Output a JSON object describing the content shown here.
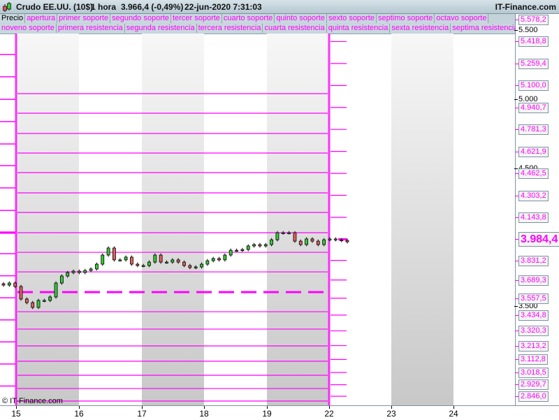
{
  "header": {
    "instrument": "Crudo EE.UU. (10$)",
    "timeframe": "1 hora",
    "last_change": "3.966,4 (-0,49%)",
    "datetime": "22-jun-2020 7:31:03",
    "site": "IT-Finance.com"
  },
  "legend": {
    "row1": [
      "Precio",
      "apertura",
      "primer soporte",
      "segundo soporte",
      "tercer soporte",
      "cuarto soporte",
      "quinto soporte",
      "sexto soporte",
      "septimo soporte",
      "octavo soporte"
    ],
    "row2": [
      "noveno soporte",
      "primera resistencia",
      "segunda resistencia",
      "tercera resistencia",
      "cuarta resistencia",
      "quinta resistencia",
      "sexta resistencia",
      "septima resistencia"
    ]
  },
  "copyright": "© IT-Finance.com",
  "colors": {
    "levels": "#ff00ff",
    "up": "#33cc33",
    "down": "#e06060",
    "axis": "#7d939e"
  },
  "chart_data": {
    "type": "candlestick",
    "ylim": [
      2846.0,
      5578.2
    ],
    "price_labels": [
      "5.578,2",
      "5.418,8",
      "5.259,4",
      "5.100,0",
      "4.940,7",
      "4.781,3",
      "4.621,9",
      "4.462,5",
      "4.303,2",
      "4.143,8",
      "3.831,2",
      "3.689,3",
      "3.557,5",
      "3.434,8",
      "3.320,3",
      "3.213,2",
      "3.112,8",
      "3.018,5",
      "2.929,7",
      "2.846,0"
    ],
    "price_values": [
      5578.2,
      5418.8,
      5259.4,
      5100.0,
      4940.7,
      4781.3,
      4621.9,
      4462.5,
      4303.2,
      4143.8,
      3831.2,
      3689.3,
      3557.5,
      3434.8,
      3320.3,
      3213.2,
      3112.8,
      3018.5,
      2929.7,
      2846.0
    ],
    "current_price_label": "3.984,4",
    "current_price": 3984.4,
    "axis_ticks": [
      {
        "label": "5.500",
        "value": 5500
      },
      {
        "label": "5.000",
        "value": 5000
      },
      {
        "label": "4.500",
        "value": 4500
      },
      {
        "label": "3.500",
        "value": 3500
      }
    ],
    "previous_levels": [
      5040.9,
      4899,
      4752,
      4610,
      4468,
      4321,
      4179,
      4032,
      3890,
      3748,
      3601,
      3459,
      3333,
      3211,
      3100,
      2998,
      2902,
      2811
    ],
    "previous_open": 3601,
    "older_levels": [
      5325,
      5163,
      5000,
      4838,
      4676,
      4519,
      4357,
      4194,
      4037,
      3880,
      3720,
      3560,
      3400,
      3240,
      3080,
      2920
    ],
    "days": [
      "15",
      "16",
      "17",
      "18",
      "19",
      "22",
      "23",
      "24"
    ],
    "closes": [
      3652,
      3667,
      3642,
      3551,
      3525,
      3490,
      3541,
      3541,
      3566,
      3667,
      3718,
      3743,
      3753,
      3743,
      3758,
      3769,
      3804,
      3870,
      3921,
      3835,
      3835,
      3855,
      3804,
      3794,
      3794,
      3819,
      3870,
      3819,
      3819,
      3835,
      3819,
      3794,
      3779,
      3784,
      3804,
      3829,
      3845,
      3835,
      3870,
      3905,
      3905,
      3910,
      3936,
      3946,
      3936,
      3946,
      3981,
      4032,
      4032,
      4032,
      3971,
      3946,
      3987,
      3971,
      3946,
      3981,
      3987,
      3981,
      3976,
      3966
    ]
  }
}
